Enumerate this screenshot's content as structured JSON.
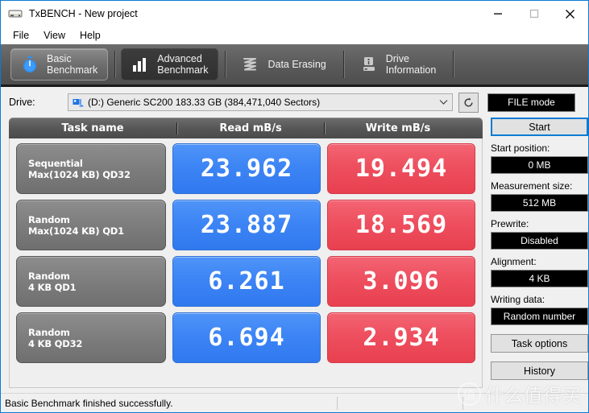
{
  "window": {
    "title": "TxBENCH - New project",
    "icon": "drive-icon",
    "controls": {
      "minimize": "minimize-icon",
      "maximize": "maximize-icon",
      "close": "close-icon"
    }
  },
  "menubar": {
    "items": [
      {
        "label": "File"
      },
      {
        "label": "View"
      },
      {
        "label": "Help"
      }
    ]
  },
  "tabs": [
    {
      "line1": "Basic",
      "line2": "Benchmark",
      "icon": "stopwatch-icon",
      "state": "active"
    },
    {
      "line1": "Advanced",
      "line2": "Benchmark",
      "icon": "bar-chart-icon",
      "state": "dark"
    },
    {
      "line1": "Data Erasing",
      "line2": "",
      "icon": "shredder-icon",
      "state": "plain"
    },
    {
      "line1": "Drive",
      "line2": "Information",
      "icon": "drive-info-icon",
      "state": "plain"
    }
  ],
  "drivebar": {
    "label": "Drive:",
    "selected": "(D:) Generic SC200  183.33 GB (384,471,040 Sectors)",
    "combo_icon": "disk-icon",
    "refresh_icon": "refresh-icon",
    "file_mode_label": "FILE mode"
  },
  "table": {
    "headers": {
      "task": "Task name",
      "read": "Read mB/s",
      "write": "Write mB/s"
    },
    "rows": [
      {
        "task_line1": "Sequential",
        "task_line2": "Max(1024 KB) QD32",
        "read": "23.962",
        "write": "19.494"
      },
      {
        "task_line1": "Random",
        "task_line2": "Max(1024 KB) QD1",
        "read": "23.887",
        "write": "18.569"
      },
      {
        "task_line1": "Random",
        "task_line2": "4 KB QD1",
        "read": "6.261",
        "write": "3.096"
      },
      {
        "task_line1": "Random",
        "task_line2": "4 KB QD32",
        "read": "6.694",
        "write": "2.934"
      }
    ]
  },
  "sidepanel": {
    "start_label": "Start",
    "start_position_label": "Start position:",
    "start_position_value": "0 MB",
    "measurement_size_label": "Measurement size:",
    "measurement_size_value": "512 MB",
    "prewrite_label": "Prewrite:",
    "prewrite_value": "Disabled",
    "alignment_label": "Alignment:",
    "alignment_value": "4 KB",
    "writing_data_label": "Writing data:",
    "writing_data_value": "Random number",
    "task_options_label": "Task options",
    "history_label": "History"
  },
  "statusbar": {
    "message": "Basic Benchmark finished successfully."
  },
  "watermark": {
    "mark": "值",
    "text": "什么值得买"
  },
  "colors": {
    "read_blue": "#3d85f5",
    "write_red": "#ee4f5f",
    "accent_blue": "#0a7bd4",
    "tab_bar": "#5a5a5a",
    "value_box_black": "#000000"
  }
}
